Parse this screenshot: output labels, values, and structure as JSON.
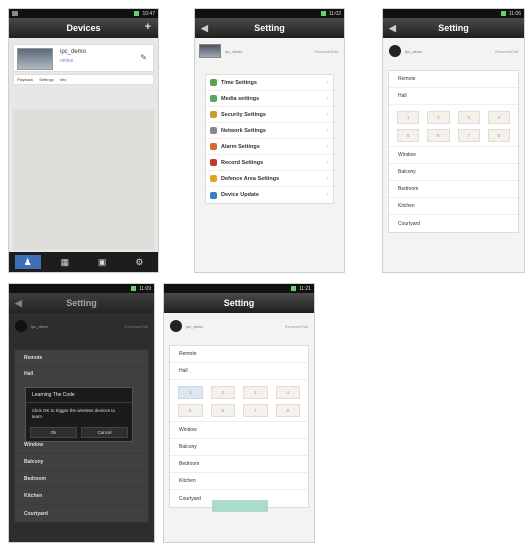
{
  "phone1": {
    "status_time": "10:47",
    "title": "Devices",
    "add_icon": "plus-icon",
    "device": {
      "name": "ipc_demo",
      "status": "online"
    },
    "actions": [
      "Playback",
      "Settings",
      "Info"
    ],
    "tabs": [
      "user-icon",
      "grid-icon",
      "folder-icon",
      "gear-icon"
    ]
  },
  "phone2": {
    "status_time": "11:02",
    "title": "Setting",
    "device_name": "ipc_demo",
    "rename": "Rename/Edit",
    "menu": [
      {
        "label": "Time Settings",
        "color": "#5aa34a"
      },
      {
        "label": "Media settings",
        "color": "#58a65b"
      },
      {
        "label": "Security Settings",
        "color": "#c0a12a"
      },
      {
        "label": "Network Settings",
        "color": "#8a8a8a"
      },
      {
        "label": "Alarm Settings",
        "color": "#d86a2a"
      },
      {
        "label": "Record Settings",
        "color": "#c0392b"
      },
      {
        "label": "Defence Area Settings",
        "color": "#e0a326"
      },
      {
        "label": "Device Update",
        "color": "#3c7bc0"
      }
    ]
  },
  "phone3": {
    "status_time": "11:06",
    "title": "Setting",
    "device_name": "ipc_demo",
    "rename": "Rename/Edit",
    "rows_top": [
      "Remote",
      "Hall"
    ],
    "cells": [
      "1",
      "2",
      "3",
      "4",
      "5",
      "6",
      "7",
      "8"
    ],
    "rows_bottom": [
      "Window",
      "Balcony",
      "Bedroom",
      "Kitchen",
      "Courtyard"
    ]
  },
  "phone4": {
    "status_time": "11:09",
    "title": "Setting",
    "device_name": "ipc_demo",
    "rename": "Rename/Edit",
    "rows": [
      "Remote",
      "Hall",
      "Window",
      "Balcony",
      "Bedroom",
      "Kitchen",
      "Courtyard"
    ],
    "dialog": {
      "title": "Learning The Code",
      "message": "Click OK to trigger the wireless devices to learn",
      "ok": "Ok",
      "cancel": "Cancel"
    }
  },
  "phone5": {
    "status_time": "11:21",
    "title": "Setting",
    "device_name": "ipc_demo",
    "rename": "Rename/Edit",
    "rows_top": [
      "Remote",
      "Hall"
    ],
    "cells": [
      "1",
      "2",
      "3",
      "4",
      "5",
      "6",
      "7",
      "8"
    ],
    "rows_bottom": [
      "Window",
      "Balcony",
      "Bedroom",
      "Kitchen",
      "Courtyard"
    ]
  }
}
